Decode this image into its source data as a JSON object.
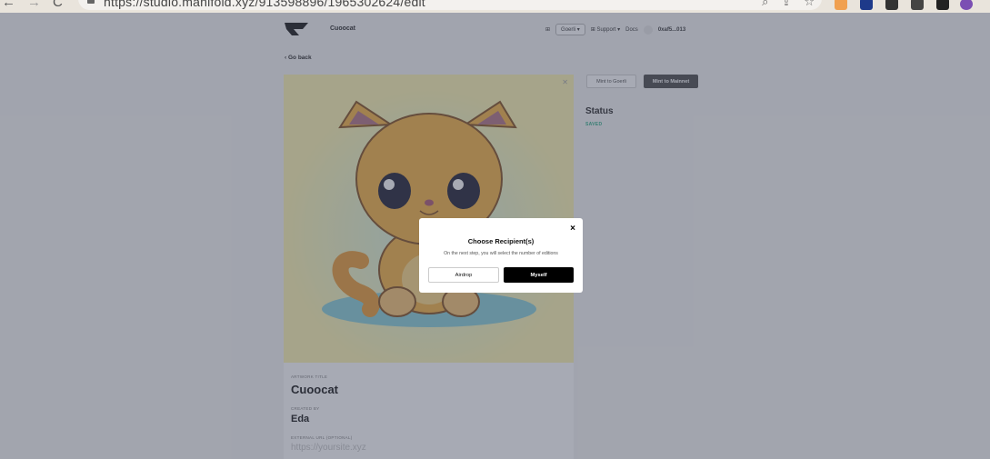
{
  "browser": {
    "url": "https://studio.manifold.xyz/913598896/1965302624/edit"
  },
  "header": {
    "project_name": "Cuoocat",
    "network_label": "Goerli",
    "support_label": "Support",
    "docs_label": "Docs",
    "account": "0xaf5...013"
  },
  "nav": {
    "go_back": "Go back"
  },
  "artwork": {
    "subject": "cartoon kitten illustration"
  },
  "details": {
    "title_label": "ARTWORK TITLE",
    "title_value": "Cuoocat",
    "creator_label": "CREATED BY",
    "creator_value": "Eda",
    "url_label": "EXTERNAL URL (OPTIONAL)",
    "url_placeholder": "https://yoursite.xyz"
  },
  "actions": {
    "mint_goerli": "Mint to Goerli",
    "mint_mainnet": "Mint to Mainnet"
  },
  "status": {
    "heading": "Status",
    "value": "SAVED"
  },
  "modal": {
    "close": "×",
    "title": "Choose Recipient(s)",
    "subtitle": "On the next step, you will select the number of editions",
    "airdrop": "Airdrop",
    "myself": "Myself"
  }
}
